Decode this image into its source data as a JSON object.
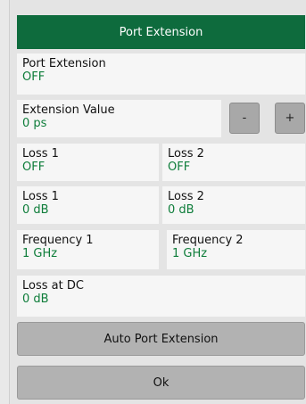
{
  "dialog": {
    "title": "Port Extension",
    "port_extension": {
      "label": "Port Extension",
      "value": "OFF"
    },
    "extension_value": {
      "label": "Extension Value",
      "value": "0 ps",
      "minus": "-",
      "plus": "+"
    },
    "loss_state": [
      {
        "label": "Loss 1",
        "value": "OFF"
      },
      {
        "label": "Loss 2",
        "value": "OFF"
      }
    ],
    "loss_db": [
      {
        "label": "Loss 1",
        "value": "0 dB"
      },
      {
        "label": "Loss 2",
        "value": "0 dB"
      }
    ],
    "frequency": [
      {
        "label": "Frequency 1",
        "value": "1 GHz"
      },
      {
        "label": "Frequency 2",
        "value": "1 GHz"
      }
    ],
    "loss_at_dc": {
      "label": "Loss at DC",
      "value": "0 dB"
    },
    "auto_button": "Auto Port Extension",
    "ok_button": "Ok"
  },
  "colors": {
    "title_bar": "#0e6b3d",
    "value_text": "#0e7d3a"
  }
}
